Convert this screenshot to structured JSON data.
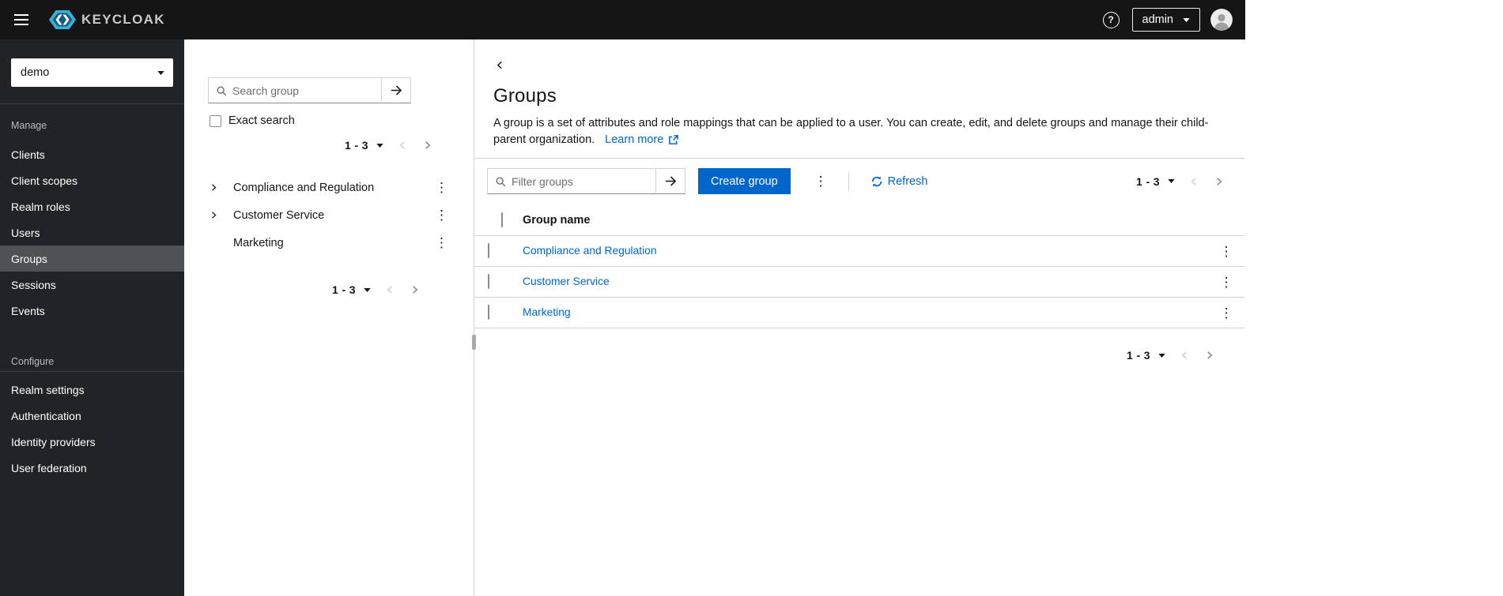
{
  "header": {
    "brand_text": "KEYCLOAK",
    "username": "admin"
  },
  "icons": {
    "kebab": "⋮",
    "help": "?"
  },
  "colors": {
    "primary": "#0066cc",
    "link": "#0066cc",
    "masthead_bg": "#151515",
    "sidebar_bg": "#212427",
    "nav_selected_bg": "#4f5255",
    "border": "#d2d2d2",
    "text": "#151515",
    "muted_text": "#6a6e73"
  },
  "sidebar": {
    "realm": "demo",
    "manage_title": "Manage",
    "manage_items": [
      "Clients",
      "Client scopes",
      "Realm roles",
      "Users",
      "Groups",
      "Sessions",
      "Events"
    ],
    "active_item": "Groups",
    "configure_title": "Configure",
    "configure_items": [
      "Realm settings",
      "Authentication",
      "Identity providers",
      "User federation"
    ]
  },
  "group_tree": {
    "search_placeholder": "Search group",
    "exact_search_label": "Exact search",
    "pagination_range": "1 - 3",
    "footer_pagination_range": "1 - 3",
    "items": [
      {
        "label": "Compliance and Regulation",
        "expandable": true
      },
      {
        "label": "Customer Service",
        "expandable": true
      },
      {
        "label": "Marketing",
        "expandable": false
      }
    ]
  },
  "main": {
    "page_title": "Groups",
    "description": "A group is a set of attributes and role mappings that can be applied to a user. You can create, edit, and delete groups and manage their child-parent organization.",
    "learn_more_label": "Learn more",
    "toolbar": {
      "filter_placeholder": "Filter groups",
      "create_button_label": "Create group",
      "refresh_label": "Refresh",
      "pagination_range": "1 - 3"
    },
    "table": {
      "column_header": "Group name",
      "rows": [
        {
          "name": "Compliance and Regulation"
        },
        {
          "name": "Customer Service"
        },
        {
          "name": "Marketing"
        }
      ]
    },
    "footer_pagination_range": "1 - 3"
  }
}
